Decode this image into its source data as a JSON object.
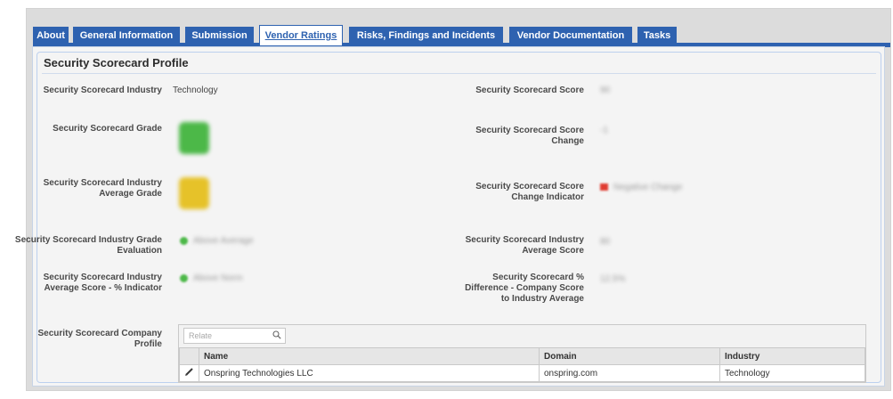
{
  "tabs": [
    {
      "label": "About"
    },
    {
      "label": "General Information"
    },
    {
      "label": "Submission"
    },
    {
      "label": "Vendor Ratings"
    },
    {
      "label": "Risks, Findings and Incidents"
    },
    {
      "label": "Vendor Documentation"
    },
    {
      "label": "Tasks"
    }
  ],
  "active_tab": "Vendor Ratings",
  "section": {
    "title": "Security Scorecard Profile"
  },
  "fields": {
    "industry": {
      "label": "Security Scorecard Industry",
      "value": "Technology"
    },
    "grade": {
      "label": "Security Scorecard Grade",
      "value": "A",
      "color": "#4cb848"
    },
    "industry_avg_grade": {
      "label": "Security Scorecard Industry Average Grade",
      "value": "B",
      "color": "#e6c229"
    },
    "grade_evaluation": {
      "label": "Security Scorecard Industry Grade Evaluation",
      "value": "Above Average",
      "color": "#4cb848"
    },
    "avg_score_indicator": {
      "label": "Security Scorecard Industry Average Score - % Indicator",
      "value": "Above Norm",
      "color": "#4cb848"
    },
    "score": {
      "label": "Security Scorecard Score",
      "value": "90"
    },
    "score_change": {
      "label": "Security Scorecard Score Change",
      "value": "-1"
    },
    "score_change_indicator": {
      "label": "Security Scorecard Score Change Indicator",
      "value": "Negative Change",
      "color": "#e03c31"
    },
    "industry_avg_score": {
      "label": "Security Scorecard Industry Average Score",
      "value": "80"
    },
    "pct_difference": {
      "label": "Security Scorecard % Difference - Company Score to Industry Average",
      "value": "12.5%"
    }
  },
  "company_profile": {
    "label": "Security Scorecard Company Profile",
    "relate_placeholder": "Relate",
    "columns": [
      "Name",
      "Domain",
      "Industry"
    ],
    "rows": [
      {
        "name": "Onspring Technologies LLC",
        "domain": "onspring.com",
        "industry": "Technology"
      }
    ]
  },
  "colors": {
    "tab_blue": "#2e62b0",
    "panel_bg": "#f4f4f4"
  }
}
